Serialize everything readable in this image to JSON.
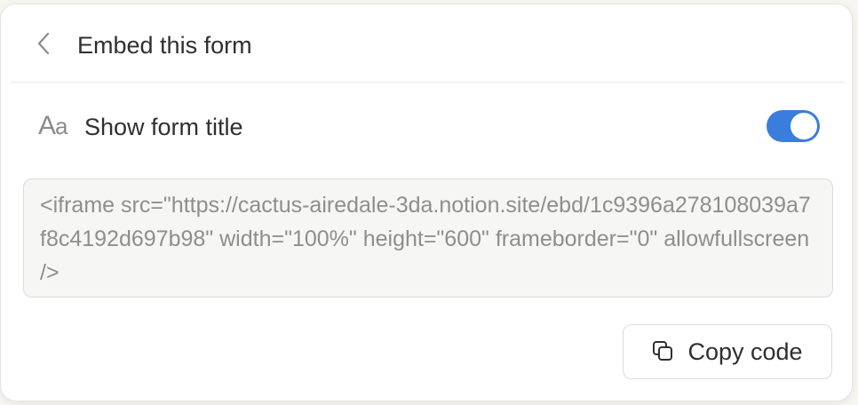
{
  "header": {
    "title": "Embed this form",
    "back_icon": "chevron-left-icon"
  },
  "toggle_row": {
    "icon": "text-aa-icon",
    "icon_text_big": "A",
    "icon_text_small": "a",
    "label": "Show form title",
    "enabled": true,
    "toggle_color": "#3b7ddd"
  },
  "embed_code": {
    "value": "<iframe src=\"https://cactus-airedale-3da.notion.site/ebd/1c9396a278108039a7f8c4192d697b98\" width=\"100%\" height=\"600\" frameborder=\"0\" allowfullscreen />"
  },
  "copy_button": {
    "label": "Copy code",
    "icon": "copy-icon"
  }
}
